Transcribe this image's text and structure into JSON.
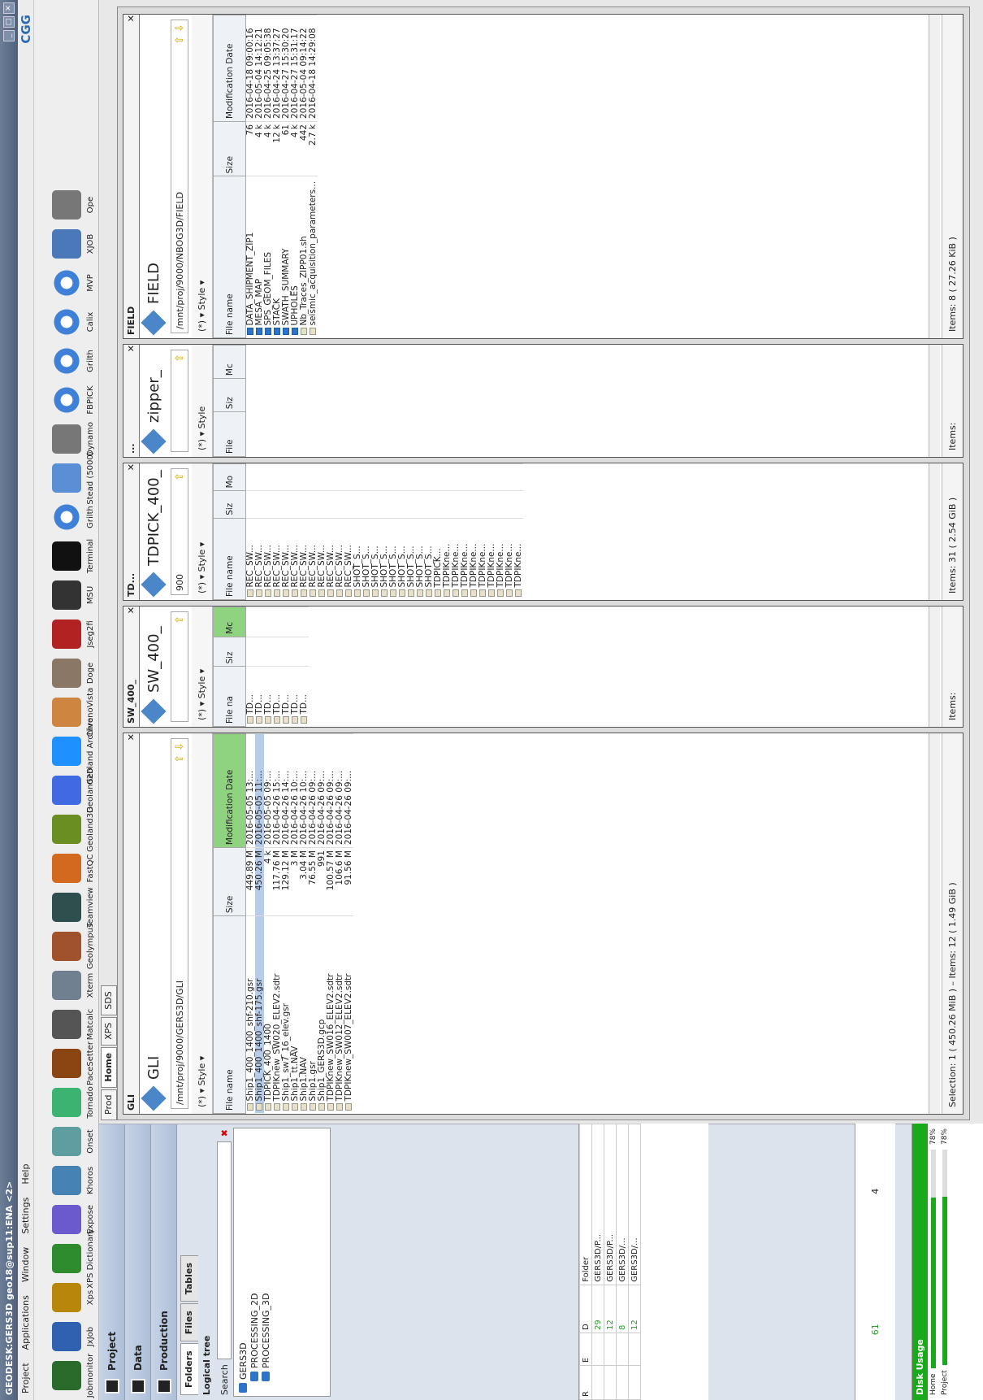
{
  "window": {
    "title": "GEODESK:GERS3D geo18@sup11:ENA <2>"
  },
  "menu": [
    "Project",
    "Applications",
    "Window",
    "Settings",
    "Help"
  ],
  "brand": "CGG",
  "toolbar": [
    {
      "label": "Jobmonitor",
      "icon": "monitor-icon",
      "color": "#2a6a2a"
    },
    {
      "label": "JxJob",
      "icon": "jxjob-icon",
      "color": "#3060b0"
    },
    {
      "label": "Xps",
      "icon": "xps-icon",
      "color": "#b8860b"
    },
    {
      "label": "XPS Dictionary",
      "icon": "dictionary-icon",
      "color": "#2e8b2e"
    },
    {
      "label": "Expose",
      "icon": "expose-icon",
      "color": "#6a5acd"
    },
    {
      "label": "Khoros",
      "icon": "khoros-icon",
      "color": "#4682b4"
    },
    {
      "label": "Onset",
      "icon": "onset-icon",
      "color": "#5f9ea0"
    },
    {
      "label": "Tornado",
      "icon": "tornado-icon",
      "color": "#3cb371"
    },
    {
      "label": "PaceSetter",
      "icon": "pacesetter-icon",
      "color": "#8b4513"
    },
    {
      "label": "Matcalc",
      "icon": "matcalc-icon",
      "color": "#555555"
    },
    {
      "label": "Xterm",
      "icon": "xterm-icon",
      "color": "#708090"
    },
    {
      "label": "Geolympus",
      "icon": "geolympus-icon",
      "color": "#a0522d"
    },
    {
      "label": "Teamview",
      "icon": "teamview-icon",
      "color": "#2f4f4f"
    },
    {
      "label": "FastQC",
      "icon": "fastqc-icon",
      "color": "#d2691e"
    },
    {
      "label": "Geoland3D",
      "icon": "geoland3d-icon",
      "color": "#6b8e23"
    },
    {
      "label": "Geoland2D",
      "icon": "geoland2d-icon",
      "color": "#4169e1"
    },
    {
      "label": "Geoland Archive",
      "icon": "archive-icon",
      "color": "#1e90ff"
    },
    {
      "label": "ChronoVista",
      "icon": "chronovista-icon",
      "color": "#cd853f"
    },
    {
      "label": "Doge",
      "icon": "doge-icon",
      "color": "#8b7765"
    },
    {
      "label": "Jseg2fi",
      "icon": "jseg2fi-icon",
      "color": "#b22222"
    },
    {
      "label": "MSU",
      "icon": "msu-icon",
      "color": "#333333"
    },
    {
      "label": "Terminal",
      "icon": "terminal-icon",
      "color": "#111111"
    },
    {
      "label": "Grilth",
      "icon": "gear-icon",
      "color": "#3f80d8"
    },
    {
      "label": "Stead (5000)",
      "icon": "stead-icon",
      "color": "#5a8fd6"
    },
    {
      "label": "Dynamo",
      "icon": "tools-icon",
      "color": "#777777"
    },
    {
      "label": "FBPICK",
      "icon": "gear-icon",
      "color": "#3f80d8"
    },
    {
      "label": "Grilth",
      "icon": "gear-icon",
      "color": "#3f80d8"
    },
    {
      "label": "Calix",
      "icon": "gear-icon",
      "color": "#3f80d8"
    },
    {
      "label": "MVP",
      "icon": "gear-icon",
      "color": "#3f80d8"
    },
    {
      "label": "XJOB",
      "icon": "xjob-icon",
      "color": "#4a78b8"
    },
    {
      "label": "Ope",
      "icon": "ope-icon",
      "color": "#777777"
    }
  ],
  "left": {
    "nav": [
      "Project",
      "Data",
      "Production"
    ],
    "tabs": [
      "Folders",
      "Files",
      "Tables"
    ],
    "logical_tree_label": "Logical tree",
    "search_label": "Search",
    "tree": [
      "GERS3D",
      "PROCESSING_2D",
      "PROCESSING_3D"
    ],
    "stats_headers": [
      "R",
      "E",
      "D",
      "Folder"
    ],
    "stats_rows": [
      {
        "r": "",
        "e": "",
        "d": "29",
        "folder": "GERS3D/P..."
      },
      {
        "r": "",
        "e": "",
        "d": "12",
        "folder": "GERS3D/P..."
      },
      {
        "r": "",
        "e": "",
        "d": "8",
        "folder": "GERS3D/..."
      },
      {
        "r": "",
        "e": "",
        "d": "12",
        "folder": "GERS3D/..."
      }
    ],
    "stats_total": "61",
    "stats_extra": "4",
    "disk_title": "Disk Usage",
    "disk": [
      {
        "label": "Home",
        "pct": "78%",
        "fill": 0.78
      },
      {
        "label": "Project",
        "pct": "78%",
        "fill": 0.78
      }
    ]
  },
  "main_tabs": [
    "Prod",
    "Home",
    "XPS",
    "SDS"
  ],
  "panes": {
    "gli": {
      "header": "GLI",
      "big": "GLI",
      "path": "/mnt/proj/9000/GERS3D/GLI",
      "style": "(*) ▾ Style ▾",
      "cols": [
        "File name",
        "Size",
        "Modification Date"
      ],
      "rows": [
        {
          "name": "Ship1_400_1400_shf-210.gsr",
          "size": "449.89 M",
          "date": "2016-05-05 13:...",
          "sel": false
        },
        {
          "name": "Ship1_400_1400_shf-175.gsr",
          "size": "450.26 M",
          "date": "2016-05-05 11:...",
          "sel": true
        },
        {
          "name": "TDPICK_400_1400",
          "size": "4 k",
          "date": "2016-05-05 09:...",
          "sel": false
        },
        {
          "name": "TDPIKnew_SW020_ELEV2.sdtr",
          "size": "117.76 M",
          "date": "2016-04-26 15:...",
          "sel": false
        },
        {
          "name": "Ship1_sw7_16_elev.gsr",
          "size": "129.12 M",
          "date": "2016-04-26 14:...",
          "sel": false
        },
        {
          "name": "Ship1_tt.NAV",
          "size": "3 M",
          "date": "2016-04-26 10:...",
          "sel": false
        },
        {
          "name": "Ship1.NAV",
          "size": "3.04 M",
          "date": "2016-04-26 10:...",
          "sel": false
        },
        {
          "name": "Ship1.gsr",
          "size": "76.55 M",
          "date": "2016-04-26 09:...",
          "sel": false
        },
        {
          "name": "Ship1_GERS3D.gcp",
          "size": "991",
          "date": "2016-04-26 09:...",
          "sel": false
        },
        {
          "name": "TDPIKnew_SW016_ELEV2.sdtr",
          "size": "100.57 M",
          "date": "2016-04-26 09:...",
          "sel": false
        },
        {
          "name": "TDPIKnew_SW012_ELEV2.sdtr",
          "size": "106.6 M",
          "date": "2016-04-26 09:...",
          "sel": false
        },
        {
          "name": "TDPIKnew_SW007_ELEV2.sdtr",
          "size": "91.56 M",
          "date": "2016-04-26 09:...",
          "sel": false
        }
      ],
      "status": "Selection: 1 ( 450.26 MiB ) – Items: 12 ( 1.49 GiB )"
    },
    "sw": {
      "header": "SW_400_",
      "big": "SW_400_",
      "style": "(*) ▾ Style ▾",
      "cols": [
        "File na",
        "Siz",
        "Mc"
      ],
      "rows": [
        "TD...",
        "TD...",
        "TD...",
        "TD...",
        "TD...",
        "TD...",
        "TD..."
      ],
      "status": "Items:"
    },
    "tdpick": {
      "header": "TD...",
      "big": "TDPICK_400_",
      "path": "900",
      "style": "(*) ▾ Style ▾",
      "cols": [
        "File name",
        "Siz",
        "Mo"
      ],
      "rows": [
        "REC_SW...",
        "REC_SW...",
        "REC_SW...",
        "REC_SW...",
        "REC_SW...",
        "REC_SW...",
        "REC_SW...",
        "REC_SW...",
        "REC_SW...",
        "REC_SW...",
        "REC_SW...",
        "REC_SW...",
        "SHOT_S...",
        "SHOT_S...",
        "SHOT_S...",
        "SHOT_S...",
        "SHOT_S...",
        "SHOT_S...",
        "SHOT_S...",
        "SHOT_S...",
        "SHOT_S...",
        "TDPICK...",
        "TDPIKne...",
        "TDPIKne...",
        "TDPIKne...",
        "TDPIKne...",
        "TDPIKne...",
        "TDPIKne...",
        "TDPIKne...",
        "TDPIKne...",
        "TDPIKne..."
      ],
      "status": "Items: 31 ( 2.54 GiB )"
    },
    "zipper": {
      "header": "...",
      "big": "zipper_",
      "style": "(*) ▾ Style",
      "cols": [
        "File",
        "Siz",
        "Mc"
      ],
      "status": "Items:"
    },
    "field": {
      "header": "FIELD",
      "big": "FIELD",
      "path": "/mnt/proj/9000/NBOG3D/FIELD",
      "style": "(*) ▾ Style ▾",
      "cols": [
        "File name",
        "Size",
        "Modification Date"
      ],
      "rows": [
        {
          "name": "DATA_SHIPMENT_ZIP1",
          "size": "76",
          "date": "2016-04-18 09:00:16",
          "dir": true
        },
        {
          "name": "MESA_MAP",
          "size": "4 k",
          "date": "2016-05-04 14:12:21",
          "dir": true
        },
        {
          "name": "SPS_GEOM_FILES",
          "size": "4 k",
          "date": "2016-04-25 09:05:38",
          "dir": true
        },
        {
          "name": "STACK",
          "size": "12 k",
          "date": "2016-04-24 13:37:27",
          "dir": true
        },
        {
          "name": "SWATH_SUMMARY",
          "size": "61",
          "date": "2016-04-27 15:30:20",
          "dir": true
        },
        {
          "name": "UPHOLES",
          "size": "4 k",
          "date": "2016-04-27 15:31:17",
          "dir": true
        },
        {
          "name": "Nb_Traces_ZIPP01.sh",
          "size": "442",
          "date": "2016-05-04 09:14:22",
          "dir": false
        },
        {
          "name": "seismic_acquisition_parameters...",
          "size": "2.7 k",
          "date": "2016-04-18 14:29:08",
          "dir": false
        }
      ],
      "status": "Items: 8 ( 27.26 KiB )"
    }
  }
}
